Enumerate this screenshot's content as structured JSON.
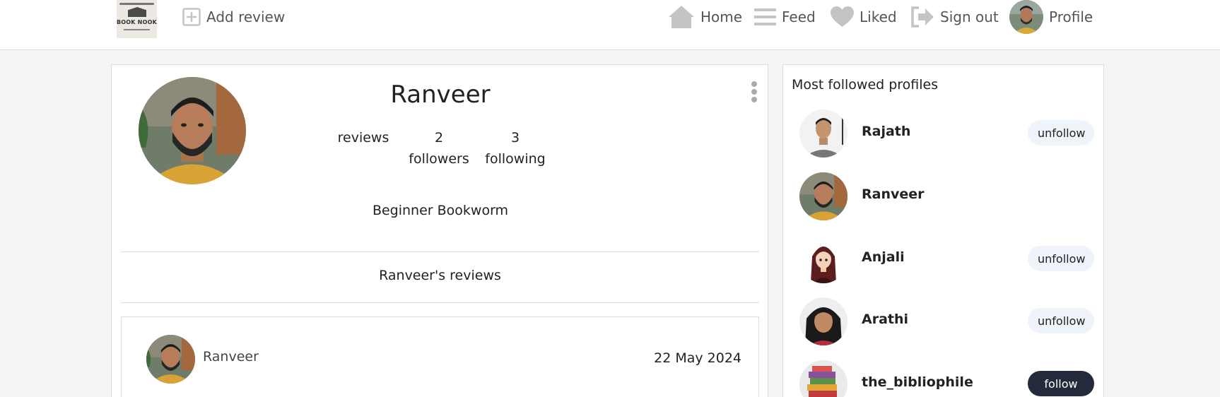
{
  "navbar": {
    "logo_text": "BOOK NOOK",
    "add_review": "Add review",
    "home": "Home",
    "feed": "Feed",
    "liked": "Liked",
    "sign_out": "Sign out",
    "profile": "Profile",
    "icon_color": "#c4c4c4"
  },
  "profile": {
    "name": "Ranveer",
    "reviews_count": "",
    "reviews_label": "reviews",
    "followers_count": "2",
    "followers_label": "followers",
    "following_count": "3",
    "following_label": "following",
    "bio": "Beginner Bookworm",
    "reviews_heading": "Ranveer's reviews"
  },
  "review": {
    "author": "Ranveer",
    "date": "22 May 2024"
  },
  "sidebar": {
    "title": "Most followed profiles",
    "profiles": [
      {
        "name": "Rajath",
        "button": "unfollow"
      },
      {
        "name": "Ranveer",
        "button": ""
      },
      {
        "name": "Anjali",
        "button": "unfollow"
      },
      {
        "name": "Arathi",
        "button": "unfollow"
      },
      {
        "name": "the_bibliophile",
        "button": "follow"
      }
    ]
  },
  "colors": {
    "follow_button": "#232a3b",
    "unfollow_button": "#eef4fa"
  }
}
